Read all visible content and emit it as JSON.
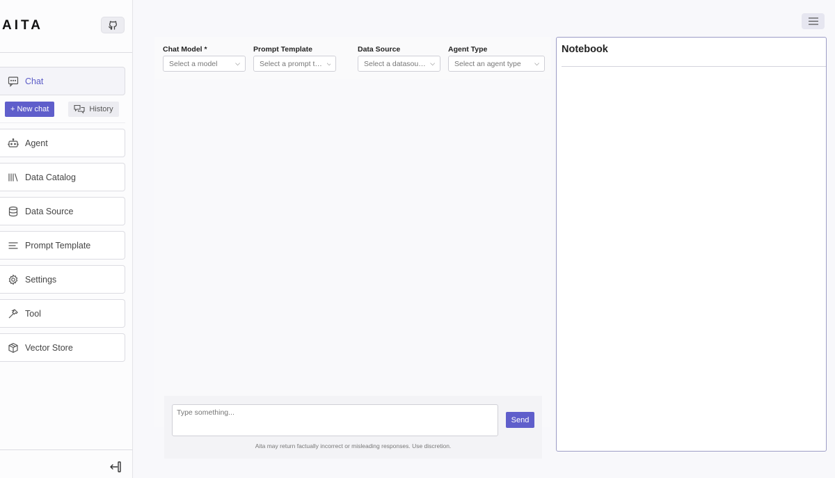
{
  "app": {
    "logo_text": "AITA"
  },
  "sidebar": {
    "items": [
      {
        "label": "Chat",
        "icon": "chat-bubble-icon"
      },
      {
        "label": "Agent",
        "icon": "robot-icon"
      },
      {
        "label": "Data Catalog",
        "icon": "library-icon"
      },
      {
        "label": "Data Source",
        "icon": "database-icon"
      },
      {
        "label": "Prompt Template",
        "icon": "text-lines-icon"
      },
      {
        "label": "Settings",
        "icon": "gear-icon"
      },
      {
        "label": "Tool",
        "icon": "hammer-icon"
      },
      {
        "label": "Vector Store",
        "icon": "cube-icon"
      }
    ],
    "new_chat_label": "+ New chat",
    "history_label": "History"
  },
  "selectors": {
    "chat_model": {
      "label": "Chat Model *",
      "placeholder": "Select a model"
    },
    "prompt_template": {
      "label": "Prompt Template",
      "placeholder": "Select a prompt template"
    },
    "data_source": {
      "label": "Data Source",
      "placeholder": "Select a datasource"
    },
    "agent_type": {
      "label": "Agent Type",
      "placeholder": "Select an agent type"
    }
  },
  "composer": {
    "placeholder": "Type something...",
    "send_label": "Send",
    "disclaimer": "Aita may return factually incorrect or misleading responses. Use discretion."
  },
  "notebook": {
    "title": "Notebook"
  },
  "colors": {
    "accent": "#5f5ecb",
    "active_nav_text": "#5a5bc7",
    "notebook_border": "#9c9cc6"
  }
}
